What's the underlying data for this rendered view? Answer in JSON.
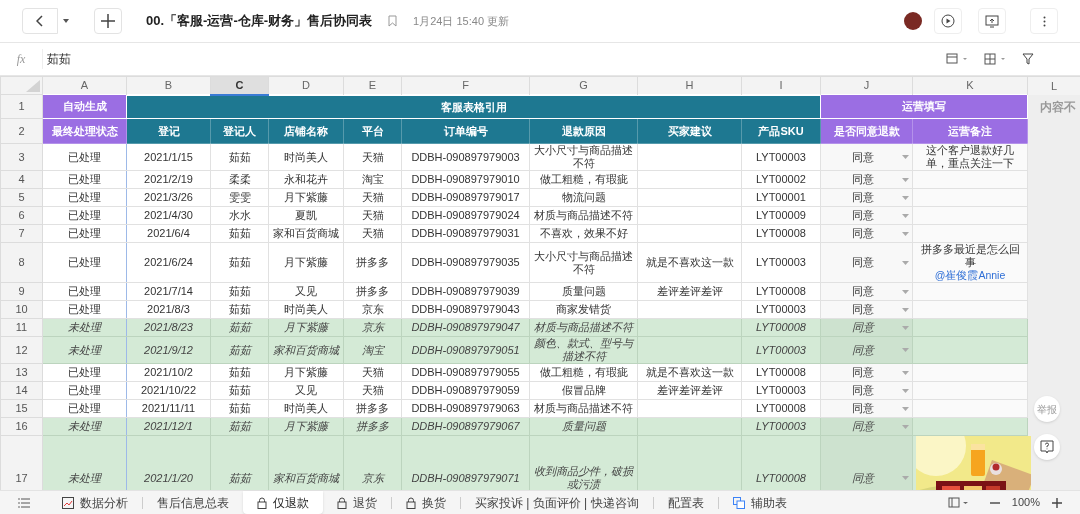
{
  "title": "00.「客服-运营-仓库-财务」售后协同表",
  "updated": "1月24日 15:40 更新",
  "formula_bar": {
    "label": "fx",
    "value": "茹茹"
  },
  "column_headers": [
    {
      "label": "A",
      "selected": false
    },
    {
      "label": "B",
      "selected": false
    },
    {
      "label": "C",
      "selected": true
    },
    {
      "label": "D",
      "selected": false
    },
    {
      "label": "E",
      "selected": false
    },
    {
      "label": "F",
      "selected": false
    },
    {
      "label": "G",
      "selected": false
    },
    {
      "label": "H",
      "selected": false
    },
    {
      "label": "I",
      "selected": false
    },
    {
      "label": "J",
      "selected": false
    },
    {
      "label": "K",
      "selected": false
    },
    {
      "label": "L",
      "selected": false
    }
  ],
  "header_row_numbers": [
    "1",
    "2"
  ],
  "header_groups": [
    {
      "label": "自动生成",
      "kind": "auto",
      "columns": [
        "最终处理状态"
      ]
    },
    {
      "label": "客服表格引用",
      "kind": "service",
      "columns": [
        "登记",
        "登记人",
        "店铺名称",
        "平台",
        "订单编号",
        "退款原因",
        "买家建议",
        "产品SKU"
      ]
    },
    {
      "label": "运营填写",
      "kind": "ops",
      "columns": [
        "是否同意退款",
        "运营备注"
      ]
    },
    {
      "label": "内容不",
      "kind": "overflow"
    }
  ],
  "rows": [
    {
      "number": "3",
      "processed": true,
      "cells": [
        "已处理",
        "2021/1/15",
        "茹茹",
        "时尚美人",
        "天猫",
        "DDBH-090897979003",
        "大小尺寸与商品描述不符",
        "",
        "LYT00003",
        "同意"
      ],
      "note": {
        "kind": "text",
        "text": "这个客户退款好几单，重点关注一下"
      }
    },
    {
      "number": "4",
      "processed": true,
      "cells": [
        "已处理",
        "2021/2/19",
        "柔柔",
        "永和花卉",
        "淘宝",
        "DDBH-090897979010",
        "做工粗糙，有瑕疵",
        "",
        "LYT00002",
        "同意"
      ]
    },
    {
      "number": "5",
      "processed": true,
      "cells": [
        "已处理",
        "2021/3/26",
        "雯雯",
        "月下紫藤",
        "天猫",
        "DDBH-090897979017",
        "物流问题",
        "",
        "LYT00001",
        "同意"
      ]
    },
    {
      "number": "6",
      "processed": true,
      "cells": [
        "已处理",
        "2021/4/30",
        "水水",
        "夏凯",
        "天猫",
        "DDBH-090897979024",
        "材质与商品描述不符",
        "",
        "LYT00009",
        "同意"
      ]
    },
    {
      "number": "7",
      "processed": true,
      "cells": [
        "已处理",
        "2021/6/4",
        "茹茹",
        "家和百货商城",
        "天猫",
        "DDBH-090897979031",
        "不喜欢，效果不好",
        "",
        "LYT00008",
        "同意"
      ]
    },
    {
      "number": "8",
      "processed": true,
      "cells": [
        "已处理",
        "2021/6/24",
        "茹茹",
        "月下紫藤",
        "拼多多",
        "DDBH-090897979035",
        "大小尺寸与商品描述不符",
        "就是不喜欢这一款",
        "LYT00003",
        "同意"
      ],
      "note": {
        "kind": "text",
        "text": "拼多多最近是怎么回事",
        "mention": "@崔俊霞Annie"
      }
    },
    {
      "number": "9",
      "processed": true,
      "cells": [
        "已处理",
        "2021/7/14",
        "茹茹",
        "又见",
        "拼多多",
        "DDBH-090897979039",
        "质量问题",
        "差评差评差评",
        "LYT00008",
        "同意"
      ]
    },
    {
      "number": "10",
      "processed": true,
      "cells": [
        "已处理",
        "2021/8/3",
        "茹茹",
        "时尚美人",
        "京东",
        "DDBH-090897979043",
        "商家发错货",
        "",
        "LYT00003",
        "同意"
      ]
    },
    {
      "number": "11",
      "processed": false,
      "cells": [
        "未处理",
        "2021/8/23",
        "茹茹",
        "月下紫藤",
        "京东",
        "DDBH-090897979047",
        "材质与商品描述不符",
        "",
        "LYT00008",
        "同意"
      ]
    },
    {
      "number": "12",
      "processed": false,
      "cells": [
        "未处理",
        "2021/9/12",
        "茹茹",
        "家和百货商城",
        "淘宝",
        "DDBH-090897979051",
        "颜色、款式、型号与描述不符",
        "",
        "LYT00003",
        "同意"
      ]
    },
    {
      "number": "13",
      "processed": true,
      "cells": [
        "已处理",
        "2021/10/2",
        "茹茹",
        "月下紫藤",
        "天猫",
        "DDBH-090897979055",
        "做工粗糙，有瑕疵",
        "就是不喜欢这一款",
        "LYT00008",
        "同意"
      ]
    },
    {
      "number": "14",
      "processed": true,
      "cells": [
        "已处理",
        "2021/10/22",
        "茹茹",
        "又见",
        "天猫",
        "DDBH-090897979059",
        "假冒品牌",
        "差评差评差评",
        "LYT00003",
        "同意"
      ]
    },
    {
      "number": "15",
      "processed": true,
      "cells": [
        "已处理",
        "2021/11/11",
        "茹茹",
        "时尚美人",
        "拼多多",
        "DDBH-090897979063",
        "材质与商品描述不符",
        "",
        "LYT00008",
        "同意"
      ]
    },
    {
      "number": "16",
      "processed": false,
      "cells": [
        "未处理",
        "2021/12/1",
        "茹茹",
        "月下紫藤",
        "拼多多",
        "DDBH-090897979067",
        "质量问题",
        "",
        "LYT00003",
        "同意"
      ]
    },
    {
      "number": "17",
      "processed": false,
      "cells": [
        "未处理",
        "2021/1/20",
        "茹茹",
        "家和百货商城",
        "京东",
        "DDBH-090897979071",
        "收到商品少件，破损或污渍",
        "",
        "LYT00008",
        "同意"
      ]
    }
  ],
  "floating_buttons": {
    "report": "举报"
  },
  "sheet_tabs": [
    {
      "label": "数据分析",
      "kind": "chart",
      "selected": false
    },
    {
      "label": "售后信息总表",
      "selected": false
    },
    {
      "label": "仅退款",
      "kind": "locked",
      "selected": true
    },
    {
      "label": "退货",
      "kind": "locked",
      "selected": false
    },
    {
      "label": "换货",
      "kind": "locked",
      "selected": false
    },
    {
      "label": "买家投诉 | 负面评价 | 快递咨询",
      "selected": false
    },
    {
      "label": "配置表",
      "selected": false
    },
    {
      "label": "辅助表",
      "kind": "helper",
      "selected": false
    }
  ],
  "zoom": "100%"
}
